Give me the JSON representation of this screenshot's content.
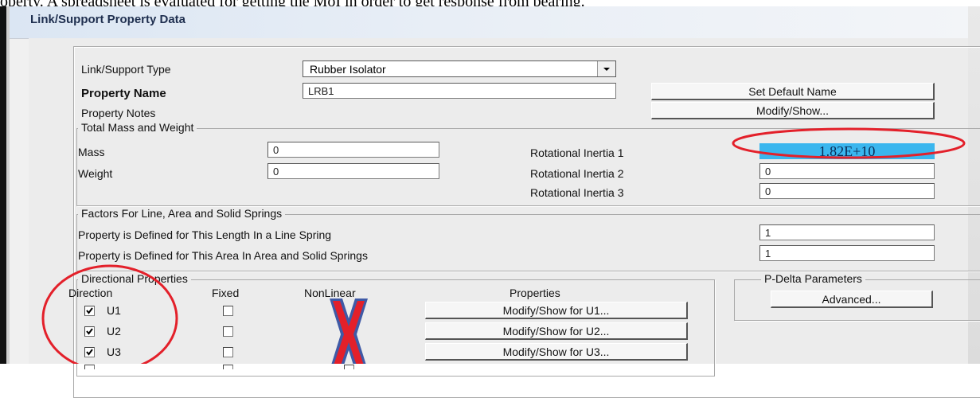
{
  "caption": "operty. A spreadsheet is evaluated for getting the MoI in order to get response from bearing.",
  "window": {
    "title": "Link/Support Property Data"
  },
  "top": {
    "type_label": "Link/Support Type",
    "type_value": "Rubber Isolator",
    "name_label": "Property Name",
    "name_value": "LRB1",
    "notes_label": "Property Notes",
    "set_default_button": "Set Default Name",
    "modify_button": "Modify/Show..."
  },
  "mass_weight": {
    "legend": "Total Mass and Weight",
    "mass_label": "Mass",
    "mass_value": "0",
    "weight_label": "Weight",
    "weight_value": "0",
    "rot1_label": "Rotational Inertia 1",
    "rot1_value": "1.82E+10",
    "rot2_label": "Rotational Inertia 2",
    "rot2_value": "0",
    "rot3_label": "Rotational Inertia 3",
    "rot3_value": "0"
  },
  "springs": {
    "legend": "Factors For Line, Area and Solid Springs",
    "line_label": "Property is Defined for This Length In a Line Spring",
    "line_value": "1",
    "area_label": "Property is Defined for This Area In Area and Solid Springs",
    "area_value": "1"
  },
  "directional": {
    "legend": "Directional Properties",
    "col_direction": "Direction",
    "col_fixed": "Fixed",
    "col_nonlinear": "NonLinear",
    "col_properties": "Properties",
    "rows": [
      {
        "dir": "U1",
        "button": "Modify/Show for U1..."
      },
      {
        "dir": "U2",
        "button": "Modify/Show for U2..."
      },
      {
        "dir": "U3",
        "button": "Modify/Show for U3..."
      }
    ]
  },
  "pdelta": {
    "legend": "P-Delta Parameters",
    "button": "Advanced..."
  },
  "annotations": {
    "circle_color": "#e3202a",
    "x_mark_color": "#e3202a",
    "x_outline_color": "#3f5aa6"
  }
}
